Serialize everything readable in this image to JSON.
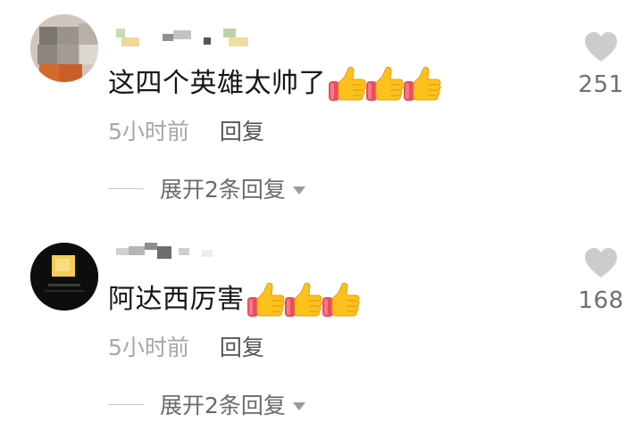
{
  "comments": [
    {
      "text": "这四个英雄太帅了",
      "emoji": "thumbs-up-icon",
      "emoji_count": 3,
      "time": "5小时前",
      "reply_label": "回复",
      "expand_label": "展开2条回复",
      "likes": "251"
    },
    {
      "text": "阿达西厉害",
      "emoji": "thumbs-up-icon",
      "emoji_count": 3,
      "time": "5小时前",
      "reply_label": "回复",
      "expand_label": "展开2条回复",
      "likes": "168"
    }
  ],
  "colors": {
    "heart": "#cccccc",
    "time_text": "#a7a7a7",
    "reply_text": "#555555",
    "count_text": "#6f6f6f",
    "thumb_yellow": "#fcc21b",
    "thumb_cuff": "#ec4c5e"
  }
}
